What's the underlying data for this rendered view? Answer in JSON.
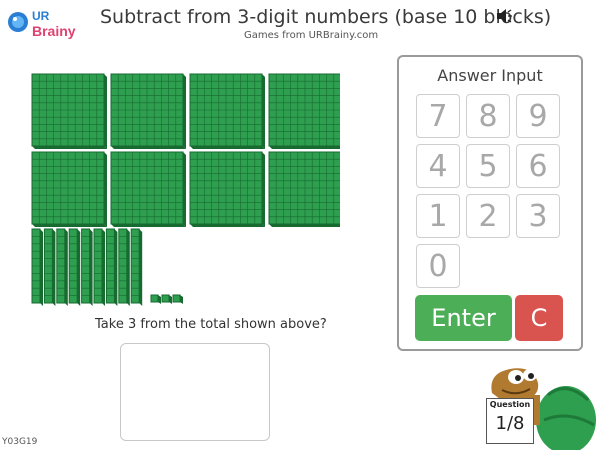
{
  "header": {
    "logo_text": "URBrainy",
    "title": "Subtract from 3-digit numbers (base 10 blocks)",
    "subtitle": "Games from URBrainy.com",
    "sound_icon": "speaker-icon"
  },
  "blocks": {
    "hundreds": 8,
    "tens": 9,
    "ones": 3,
    "color": "#2e9e4f",
    "grid_color": "#176b31"
  },
  "question": {
    "text": "Take 3 from the total shown above?"
  },
  "answer_panel": {
    "title": "Answer Input",
    "keys": [
      "7",
      "8",
      "9",
      "4",
      "5",
      "6",
      "1",
      "2",
      "3",
      "0"
    ],
    "enter_label": "Enter",
    "clear_label": "C",
    "enter_color": "#4cae56",
    "clear_color": "#d9534f"
  },
  "footer": {
    "code": "Y03G19",
    "question_label": "Question",
    "question_count": "1/8"
  }
}
